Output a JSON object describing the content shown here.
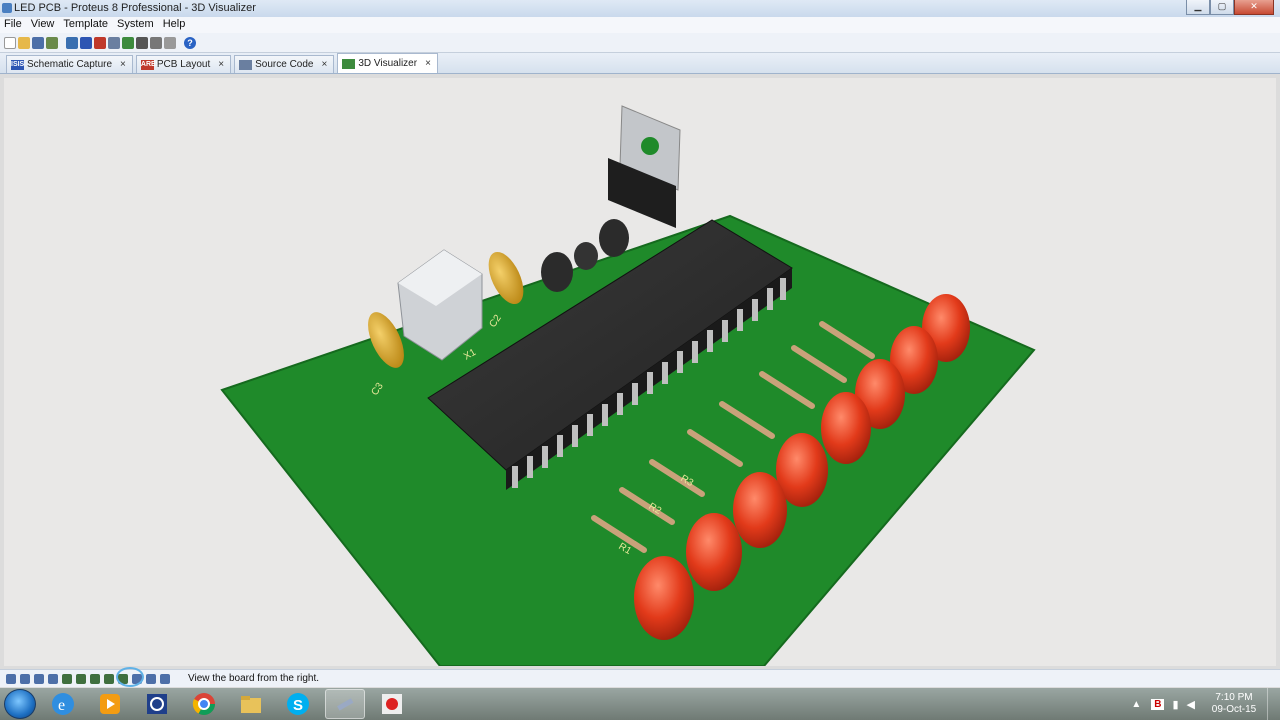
{
  "window": {
    "title": "LED PCB - Proteus 8 Professional - 3D Visualizer",
    "controls": {
      "minimize": "▁",
      "maximize": "▢",
      "close": "✕"
    }
  },
  "menu": [
    "File",
    "View",
    "Template",
    "System",
    "Help"
  ],
  "toolbar": {
    "icons": [
      "new-icon",
      "open-icon",
      "save-icon",
      "import-icon",
      "home-icon",
      "isis-icon",
      "ares-icon",
      "vsm-icon",
      "bom-icon",
      "design-explorer-icon",
      "gerber-icon",
      "notes-icon",
      "help-icon"
    ]
  },
  "tabs": [
    {
      "label": "Schematic Capture",
      "badge": "ISIS",
      "badge_color": "#2d55b3",
      "close": "×"
    },
    {
      "label": "PCB Layout",
      "badge": "ARES",
      "badge_color": "#c0392b",
      "close": "×"
    },
    {
      "label": "Source Code",
      "badge": "",
      "badge_color": "#6a7fa0",
      "close": "×"
    },
    {
      "label": "3D Visualizer",
      "badge": "",
      "badge_color": "#3d8b3d",
      "close": "×",
      "active": true
    }
  ],
  "board": {
    "labels": {
      "c3": "C3",
      "x1": "X1",
      "c2": "C2",
      "r1": "R1",
      "r2": "R2",
      "r3": "R3"
    },
    "colors": {
      "pcb": "#1f8a2a",
      "led": "#e23a1a",
      "chip": "#2b2b2b",
      "capacitor": "#d8a21a",
      "silkscreen": "#e8e89a"
    }
  },
  "statusbar": {
    "icons": [
      "pan-icon",
      "zoom-in-icon",
      "zoom-out-icon",
      "refresh-icon",
      "view-top-icon",
      "view-bottom-icon",
      "view-front-icon",
      "view-back-icon",
      "view-left-icon",
      "view-right-icon",
      "dimensions-icon",
      "settings-icon"
    ],
    "message": "View the board from the right."
  },
  "taskbar": {
    "apps": [
      "internet-explorer-icon",
      "media-player-icon",
      "proteus-isis-icon",
      "chrome-icon",
      "file-explorer-icon",
      "skype-icon",
      "tool-icon",
      "recorder-icon"
    ],
    "tray": {
      "flag": "B",
      "time": "7:10 PM",
      "date": "09-Oct-15"
    }
  }
}
